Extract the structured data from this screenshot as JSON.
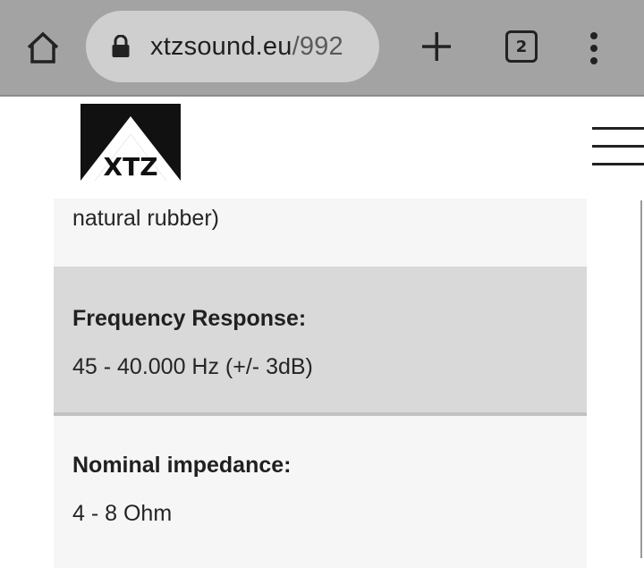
{
  "browser": {
    "url_host": "xtzsound.eu",
    "url_path": "/992",
    "tab_count": "2",
    "icons": {
      "home": "home-icon",
      "lock": "lock-icon",
      "new_tab": "plus-icon",
      "tabs": "tab-switcher-icon",
      "menu": "more-vert-icon"
    }
  },
  "header": {
    "logo_text": "XTZ",
    "menu_icon": "hamburger-icon"
  },
  "specs": [
    {
      "label": "",
      "value": "natural rubber)"
    },
    {
      "label": "Frequency Response:",
      "value": "45 - 40.000 Hz (+/- 3dB)"
    },
    {
      "label": "Nominal impedance:",
      "value": "4 - 8 Ohm"
    }
  ],
  "colors": {
    "toolbar_bg": "#a3a3a3",
    "url_pill_bg": "#cfcfcf",
    "row_light": "#f6f6f6",
    "row_dark": "#d9d9d9"
  }
}
